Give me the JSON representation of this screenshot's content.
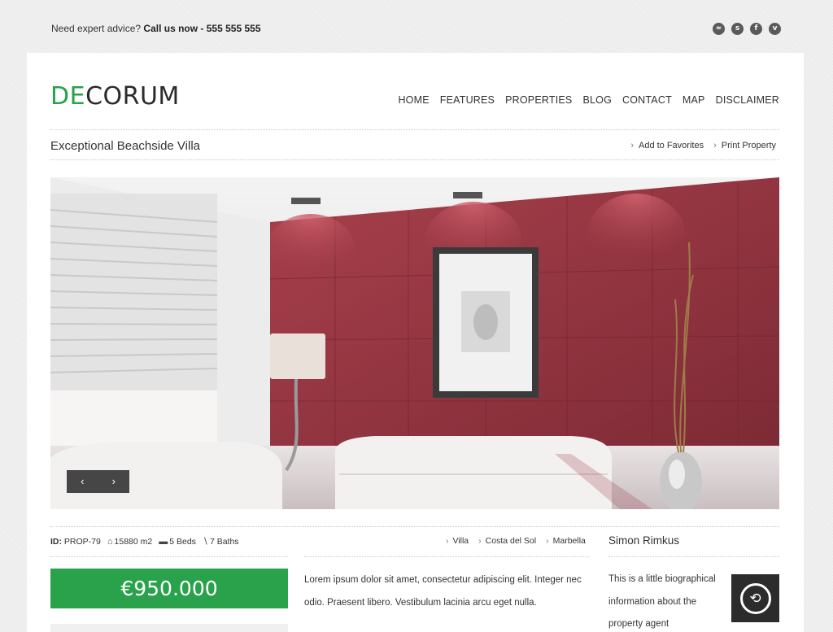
{
  "topbar": {
    "advice_text": "Need expert advice?",
    "call_text": "Call us now - 555 555 555",
    "social_icons": [
      "rss-icon",
      "skype-icon",
      "facebook-icon",
      "vimeo-icon"
    ]
  },
  "brand": {
    "logo_accent": "DE",
    "logo_rest": "CORUM",
    "accent_color": "#27a24a"
  },
  "nav": {
    "items": [
      {
        "label": "HOME"
      },
      {
        "label": "FEATURES"
      },
      {
        "label": "PROPERTIES"
      },
      {
        "label": "BLOG"
      },
      {
        "label": "CONTACT"
      },
      {
        "label": "MAP"
      },
      {
        "label": "DISCLAIMER"
      }
    ]
  },
  "property": {
    "title": "Exceptional Beachside Villa",
    "add_favorites": "Add to Favorites",
    "print_property": "Print Property",
    "id_label": "ID:",
    "id_value": "PROP-79",
    "area": "15880 m2",
    "beds": "5 Beds",
    "baths": "7 Baths",
    "locations": [
      "Villa",
      "Costa del Sol",
      "Marbella"
    ],
    "price": "€950.000",
    "description": "Lorem ipsum dolor sit amet, consectetur adipiscing elit. Integer nec odio. Praesent libero. Vestibulum lacinia arcu eget nulla."
  },
  "slider": {
    "prev": "‹",
    "next": "›"
  },
  "agent": {
    "name": "Simon Rimkus",
    "bio": "This is a little biographical information about the property agent"
  }
}
